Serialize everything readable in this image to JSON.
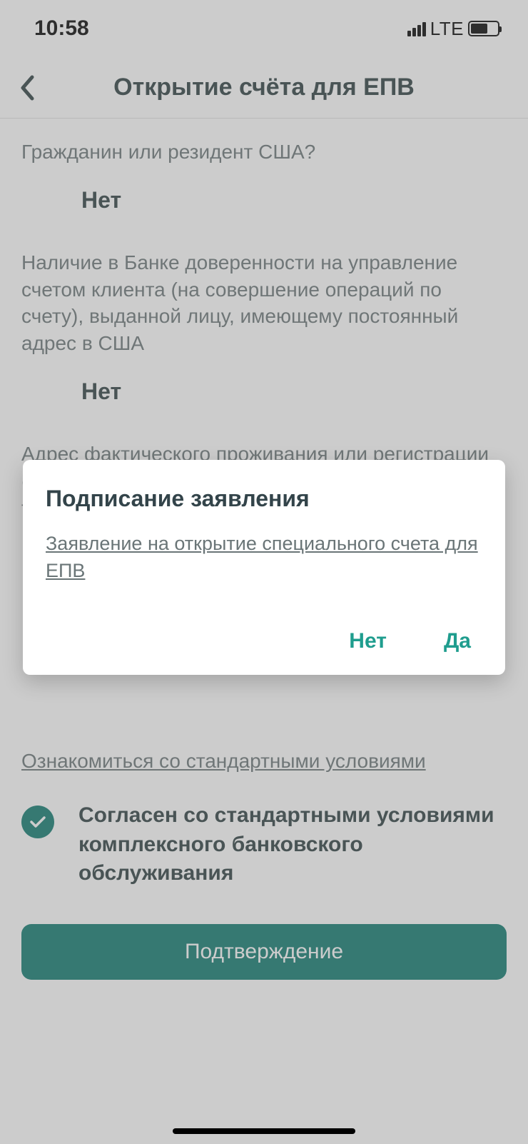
{
  "status": {
    "time": "10:58",
    "network": "LTE"
  },
  "header": {
    "title": "Открытие счёта для ЕПВ"
  },
  "questions": [
    {
      "label": "Гражданин или резидент США?",
      "answer": "Нет"
    },
    {
      "label": "Наличие в Банке доверенности на управление счетом клиента (на совершение операций по счету), выданной лицу, имеющему постоянный адрес в США",
      "answer": "Нет"
    },
    {
      "label": "Адрес фактического проживания или регистрации (в том числе наличие почтового ящика или телефонного номера) в США?",
      "answer": ""
    }
  ],
  "terms_link": "Ознакомиться со стандартными условиями",
  "agree_text": "Согласен со стандартными условиями комплексного банковского обслуживания",
  "confirm_button": "Подтверждение",
  "dialog": {
    "title": "Подписание заявления",
    "link": "Заявление на открытие специального счета для ЕПВ",
    "no": "Нет",
    "yes": "Да"
  }
}
